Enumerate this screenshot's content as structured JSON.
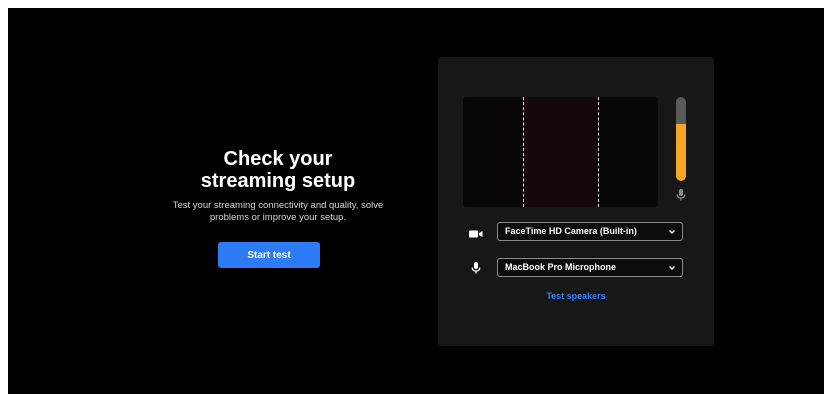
{
  "intro": {
    "title_line1": "Check your",
    "title_line2": "streaming setup",
    "description_line1": "Test your streaming connectivity and quality, solve",
    "description_line2": "problems or improve your setup.",
    "start_button": "Start test"
  },
  "device_panel": {
    "mic_level": 0.68,
    "camera": {
      "icon": "video-camera-icon",
      "selected": "FaceTime HD Camera (Built-in)"
    },
    "microphone": {
      "icon": "microphone-icon",
      "selected": "MacBook Pro Microphone"
    },
    "test_speakers": "Test speakers"
  },
  "colors": {
    "background": "#000000",
    "panel": "#171717",
    "accent": "#2d7cf6",
    "meter_fill": "#f6a623",
    "meter_track": "#5a5a5a"
  }
}
